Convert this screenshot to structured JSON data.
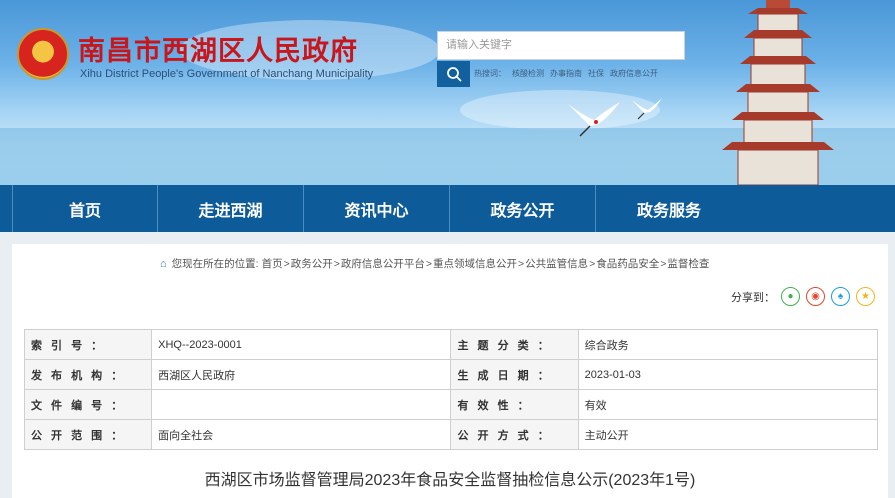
{
  "header": {
    "title": "南昌市西湖区人民政府",
    "subtitle": "Xihu District People's Government of Nanchang Municipality",
    "search": {
      "placeholder": "请输入关键字"
    },
    "hotwords": {
      "label": "热搜词：",
      "items": [
        "核酸检测",
        "办事指南",
        "社保",
        "政府信息公开"
      ]
    }
  },
  "nav": {
    "items": [
      "首页",
      "走进西湖",
      "资讯中心",
      "政务公开",
      "政务服务"
    ]
  },
  "breadcrumb": {
    "prefix": "您现在所在的位置:",
    "items": [
      "首页",
      "政务公开",
      "政府信息公开平台",
      "重点领域信息公开",
      "公共监管信息",
      "食品药品安全",
      "监督检查"
    ],
    "separator": ">"
  },
  "share": {
    "label": "分享到：",
    "buttons": [
      "wechat-icon",
      "weibo-icon",
      "qq-icon",
      "qzone-icon"
    ]
  },
  "meta": {
    "rows": [
      {
        "l1": "索 引 号 ：",
        "v1": "XHQ--2023-0001",
        "l2": "主 题 分 类 ：",
        "v2": "综合政务"
      },
      {
        "l1": "发 布 机 构 ：",
        "v1": "西湖区人民政府",
        "l2": "生 成 日 期 ：",
        "v2": "2023-01-03"
      },
      {
        "l1": "文 件 编 号 ：",
        "v1": "",
        "l2": "有 效 性 ：",
        "v2": "有效"
      },
      {
        "l1": "公 开 范 围 ：",
        "v1": "面向全社会",
        "l2": "公 开 方 式 ：",
        "v2": "主动公开"
      }
    ]
  },
  "article": {
    "title": "西湖区市场监督管理局2023年食品安全监督抽检信息公示(2023年1号)"
  },
  "colors": {
    "nav": "#0e5b9a",
    "title_red": "#c8161d",
    "search_button": "#12619e"
  }
}
